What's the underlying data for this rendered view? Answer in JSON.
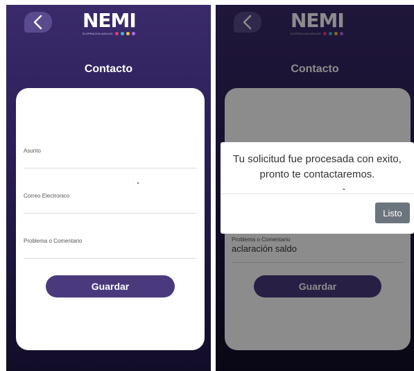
{
  "app": {
    "logo_text": "NEMI",
    "logo_tagline": "ELOPRACION AVELIGENTE",
    "logo_dot_colors": [
      "#e6397c",
      "#3bb6e8",
      "#f2c230",
      "#b56be6"
    ],
    "page_title": "Contacto"
  },
  "left_form": {
    "fields": [
      {
        "label": "Asunto",
        "value": ""
      },
      {
        "label": "Correo Electronico",
        "value": ""
      },
      {
        "label": "Problema o Comentario",
        "value": ""
      }
    ],
    "save_label": "Guardar"
  },
  "right_form": {
    "fields": [
      {
        "label": "Problema o Comentario",
        "value": "aclaración saldo"
      }
    ],
    "save_label": "Guardar"
  },
  "dialog": {
    "message": "Tu solicitud fue procesada con exito, pronto te contactaremos.",
    "confirm_label": "Listo"
  },
  "colors": {
    "accent_button": "#4a3a7d",
    "dialog_button": "#6c757d"
  }
}
